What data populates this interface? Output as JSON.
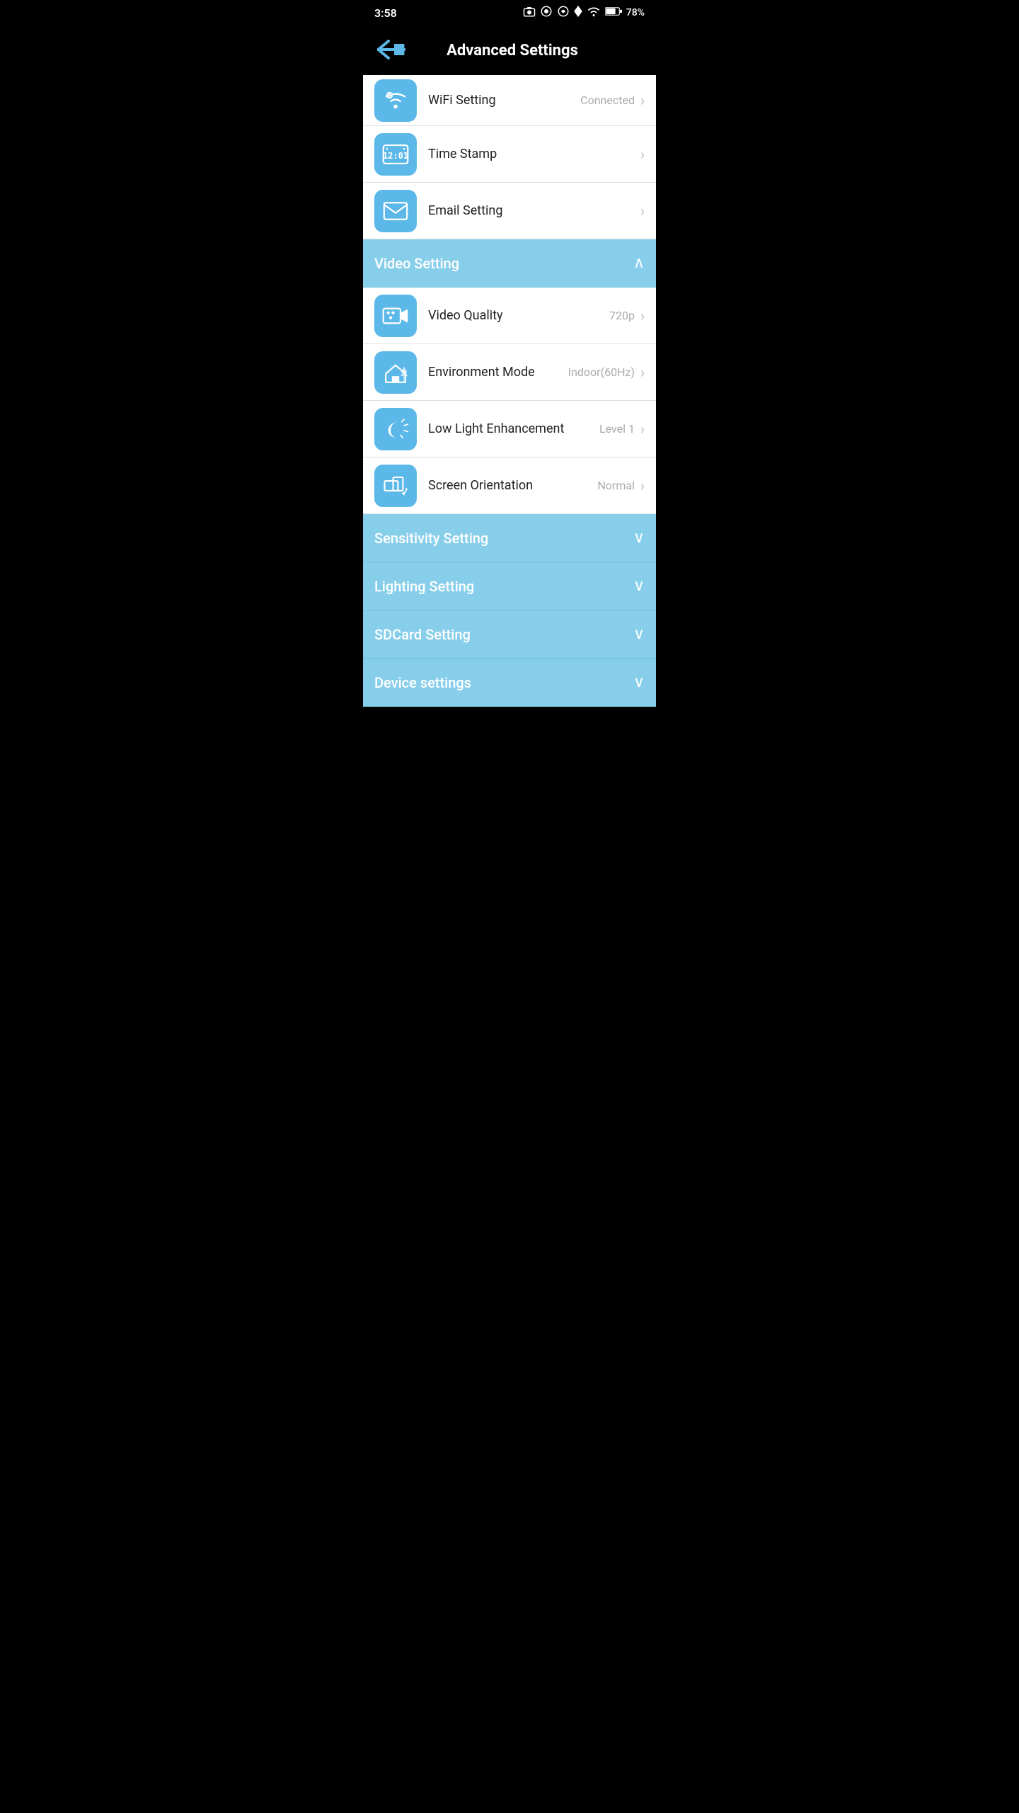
{
  "statusBar": {
    "time": "3:58",
    "battery": "78%",
    "icons": [
      "photo",
      "circle1",
      "circle2",
      "diamond",
      "wifi",
      "battery"
    ]
  },
  "header": {
    "title": "Advanced Settings",
    "backLabel": "back"
  },
  "wifiItem": {
    "label": "WiFi Setting",
    "value": "Connected",
    "iconAlt": "wifi-icon"
  },
  "items": [
    {
      "id": "time-stamp",
      "label": "Time Stamp",
      "value": "",
      "iconAlt": "clock-icon"
    },
    {
      "id": "email-setting",
      "label": "Email Setting",
      "value": "",
      "iconAlt": "email-icon"
    }
  ],
  "videoSection": {
    "label": "Video Setting",
    "expanded": true,
    "items": [
      {
        "id": "video-quality",
        "label": "Video Quality",
        "value": "720p",
        "iconAlt": "video-camera-icon"
      },
      {
        "id": "environment-mode",
        "label": "Environment Mode",
        "value": "Indoor(60Hz)",
        "iconAlt": "environment-icon"
      },
      {
        "id": "low-light",
        "label": "Low Light Enhancement",
        "value": "Level 1",
        "iconAlt": "moon-icon"
      },
      {
        "id": "screen-orientation",
        "label": "Screen Orientation",
        "value": "Normal",
        "iconAlt": "orientation-icon"
      }
    ]
  },
  "collapsedSections": [
    {
      "id": "sensitivity",
      "label": "Sensitivity Setting"
    },
    {
      "id": "lighting",
      "label": "Lighting Setting"
    },
    {
      "id": "sdcard",
      "label": "SDCard Setting"
    },
    {
      "id": "device",
      "label": "Device settings"
    }
  ]
}
